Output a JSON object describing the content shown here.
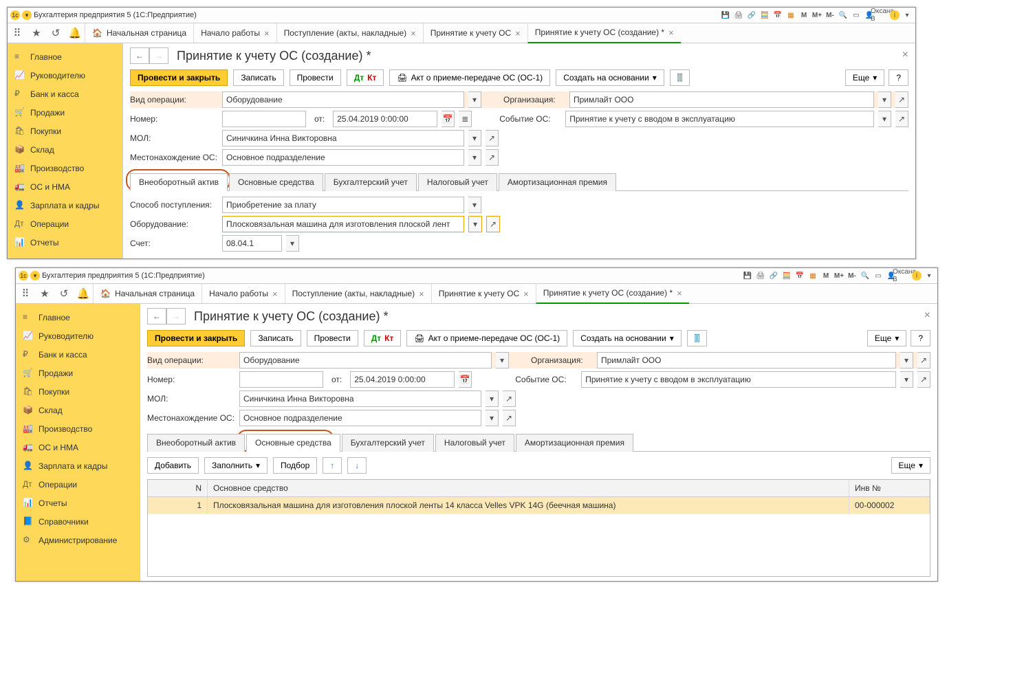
{
  "title": "Бухгалтерия предприятия 5   (1С:Предприятие)",
  "user": "Оксана В",
  "mem": {
    "m": "M",
    "mp": "M+",
    "mm": "M-"
  },
  "home_tab": "Начальная страница",
  "tabs": [
    {
      "label": "Начало работы"
    },
    {
      "label": "Поступление (акты, накладные)"
    },
    {
      "label": "Принятие к учету ОС"
    },
    {
      "label": "Принятие к учету ОС (создание) *",
      "active": true
    }
  ],
  "sidebar": [
    "Главное",
    "Руководителю",
    "Банк и касса",
    "Продажи",
    "Покупки",
    "Склад",
    "Производство",
    "ОС и НМА",
    "Зарплата и кадры",
    "Операции",
    "Отчеты",
    "Справочники",
    "Администрирование"
  ],
  "doc_title": "Принятие к учету ОС (создание) *",
  "buttons": {
    "post_close": "Провести и закрыть",
    "write": "Записать",
    "post": "Провести",
    "act": "Акт о приеме-передаче ОС (ОС-1)",
    "create_based": "Создать на основании",
    "more": "Еще",
    "help": "?",
    "add": "Добавить",
    "fill": "Заполнить",
    "pick": "Подбор"
  },
  "labels": {
    "op_type": "Вид операции:",
    "org": "Организация:",
    "number": "Номер:",
    "from": "от:",
    "event": "Событие ОС:",
    "mol": "МОЛ:",
    "loc": "Местонахождение ОС:",
    "method": "Способ поступления:",
    "equip": "Оборудование:",
    "acc": "Счет:"
  },
  "values": {
    "op_type": "Оборудование",
    "org": "Примлайт ООО",
    "date": "25.04.2019  0:00:00",
    "event": "Принятие к учету с вводом в эксплуатацию",
    "mol": "Синичкина Инна Викторовна",
    "loc": "Основное подразделение",
    "method": "Приобретение за плату",
    "equip": "Плосковязальная машина для изготовления плоской лент",
    "acc": "08.04.1"
  },
  "subtabs": [
    "Внеоборотный актив",
    "Основные средства",
    "Бухгалтерский учет",
    "Налоговый учет",
    "Амортизационная премия"
  ],
  "table": {
    "cols": {
      "n": "N",
      "main": "Основное средство",
      "inv": "Инв №"
    },
    "row": {
      "n": "1",
      "main": "Плосковязальная машина для изготовления плоской ленты 14 класса Velles VPK 14G (беечная машина)",
      "inv": "00-000002"
    }
  }
}
